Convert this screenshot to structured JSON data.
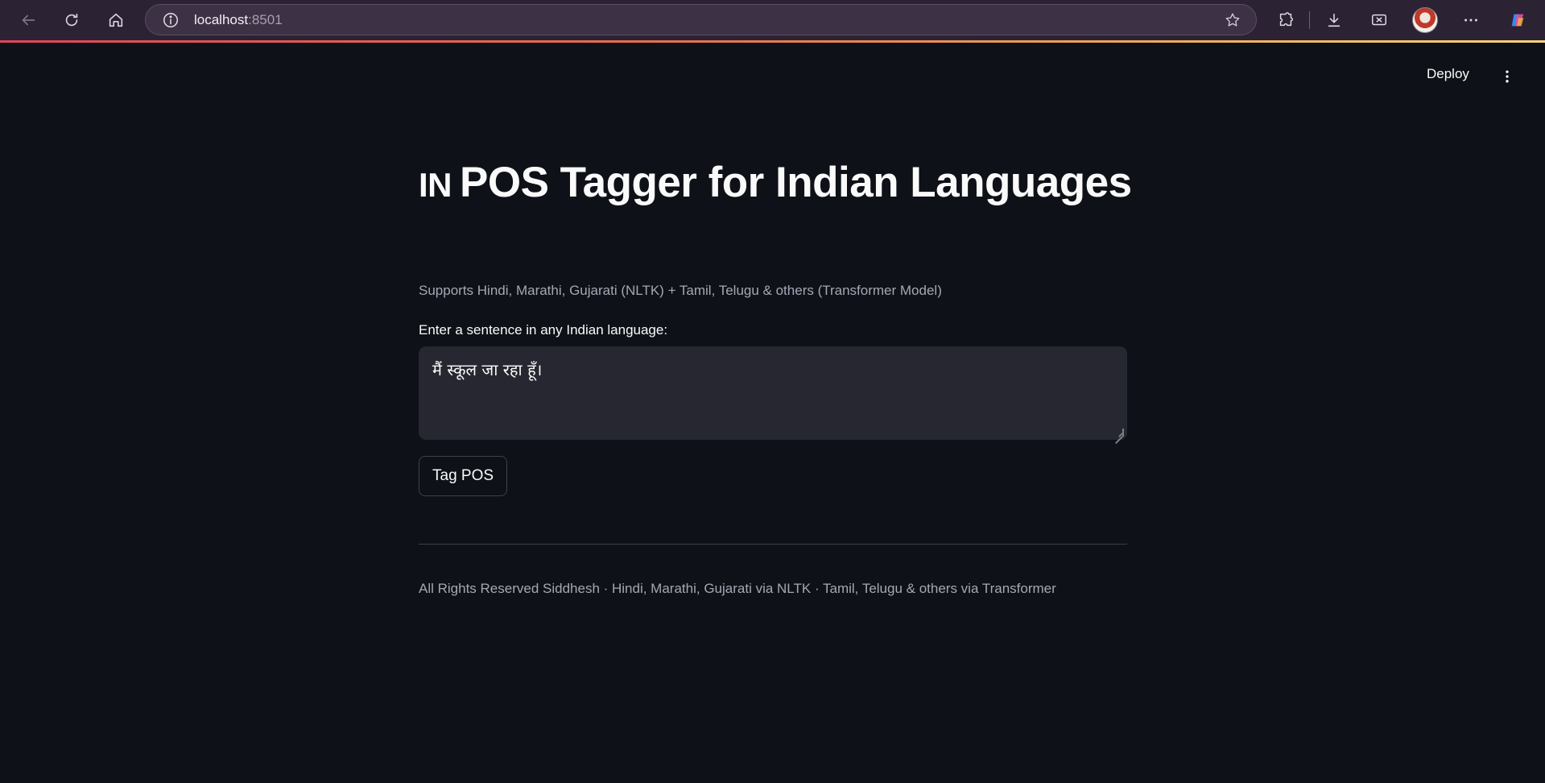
{
  "browser": {
    "url_host": "localhost",
    "url_port": ":8501"
  },
  "header": {
    "deploy_label": "Deploy"
  },
  "main": {
    "title_flag": "IN",
    "title": "POS Tagger for Indian Languages",
    "subtitle": "Supports Hindi, Marathi, Gujarati (NLTK) + Tamil, Telugu & others (Transformer Model)",
    "input_label": "Enter a sentence in any Indian language:",
    "input_value": "मैं स्कूल जा रहा हूँ।",
    "button_label": "Tag POS",
    "footer": "All Rights Reserved Siddhesh · Hindi, Marathi, Gujarati via NLTK · Tamil, Telugu & others via Transformer"
  }
}
